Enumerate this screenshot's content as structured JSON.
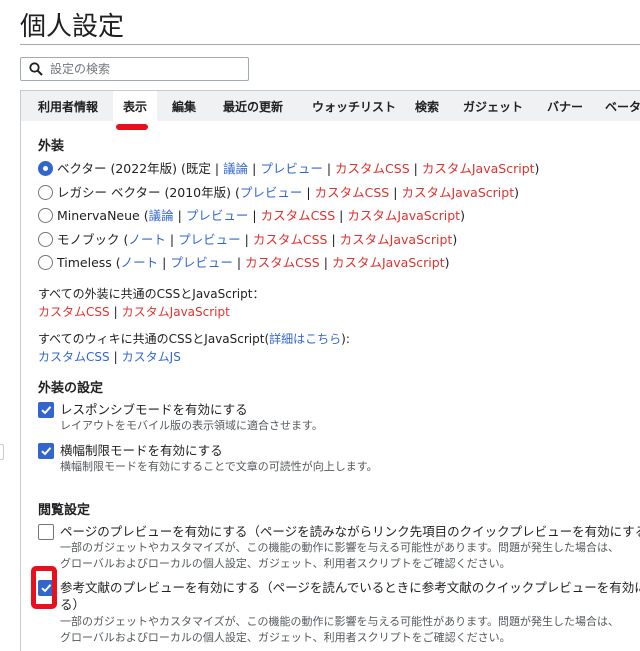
{
  "page": {
    "title": "個人設定"
  },
  "search": {
    "placeholder": "設定の検索"
  },
  "tabs": [
    "利用者情報",
    "表示",
    "編集",
    "最近の更新",
    "ウォッチリスト",
    "検索",
    "ガジェット",
    "バナー",
    "ベータ"
  ],
  "active_tab": "表示",
  "skin": {
    "heading": "外装",
    "options": [
      {
        "name": "ベクター (2022年版)",
        "note": "(既定 |",
        "talk": "議論",
        "preview": "プレビュー",
        "css": "カスタムCSS",
        "js": "カスタムJavaScript",
        "selected": true
      },
      {
        "name": "レガシー ベクター (2010年版)",
        "preview": "プレビュー",
        "css": "カスタムCSS",
        "js": "カスタムJavaScript",
        "selected": false
      },
      {
        "name": "MinervaNeue",
        "talk": "議論",
        "preview": "プレビュー",
        "css": "カスタムCSS",
        "js": "カスタムJavaScript",
        "selected": false
      },
      {
        "name": "モノブック",
        "talk": "ノート",
        "preview": "プレビュー",
        "css": "カスタムCSS",
        "js": "カスタムJavaScript",
        "selected": false
      },
      {
        "name": "Timeless",
        "talk": "ノート",
        "preview": "プレビュー",
        "css": "カスタムCSS",
        "js": "カスタムJavaScript",
        "selected": false
      }
    ],
    "common_label": "すべての外装に共通のCSSとJavaScript：",
    "common_css": "カスタムCSS",
    "common_js": "カスタムJavaScript",
    "global_label_prefix": "すべてのウィキに共通のCSSとJavaScript(",
    "global_label_link": "詳細はこちら",
    "global_label_suffix": "):",
    "global_css": "カスタムCSS",
    "global_js": "カスタムJS"
  },
  "skin_prefs": {
    "heading": "外装の設定",
    "items": [
      {
        "label": "レスポンシブモードを有効にする",
        "help": "レイアウトをモバイル版の表示領域に適合させます。",
        "checked": true
      },
      {
        "label": "横幅制限モードを有効にする",
        "help": "横幅制限モードを有効にすることで文章の可読性が向上します。",
        "checked": true
      }
    ]
  },
  "reading": {
    "heading": "閲覧設定",
    "items": [
      {
        "label": "ページのプレビューを有効にする（ページを読みながらリンク先項目のクイックプレビューを有効にする）",
        "help1": "一部のガジェットやカスタマイズが、この機能の動作に影響を与える可能性があります。問題が発生した場合は、",
        "help2": "グローバルおよびローカルの個人設定、ガジェット、利用者スクリプトをご確認ください。",
        "checked": false
      },
      {
        "label": "参考文献のプレビューを有効にする（ページを読んでいるときに参考文献のクイックプレビューを有効にす",
        "label2": "る）",
        "help1": "一部のガジェットやカスタマイズが、この機能の動作に影響を与える可能性があります。問題が発生した場合は、",
        "help2": "グローバルおよびローカルの個人設定、ガジェット、利用者スクリプトをご確認ください。",
        "checked": true
      }
    ]
  },
  "colors": {
    "accent": "#3366cc",
    "red_link": "#dd3333",
    "annotation": "#e8101d"
  }
}
